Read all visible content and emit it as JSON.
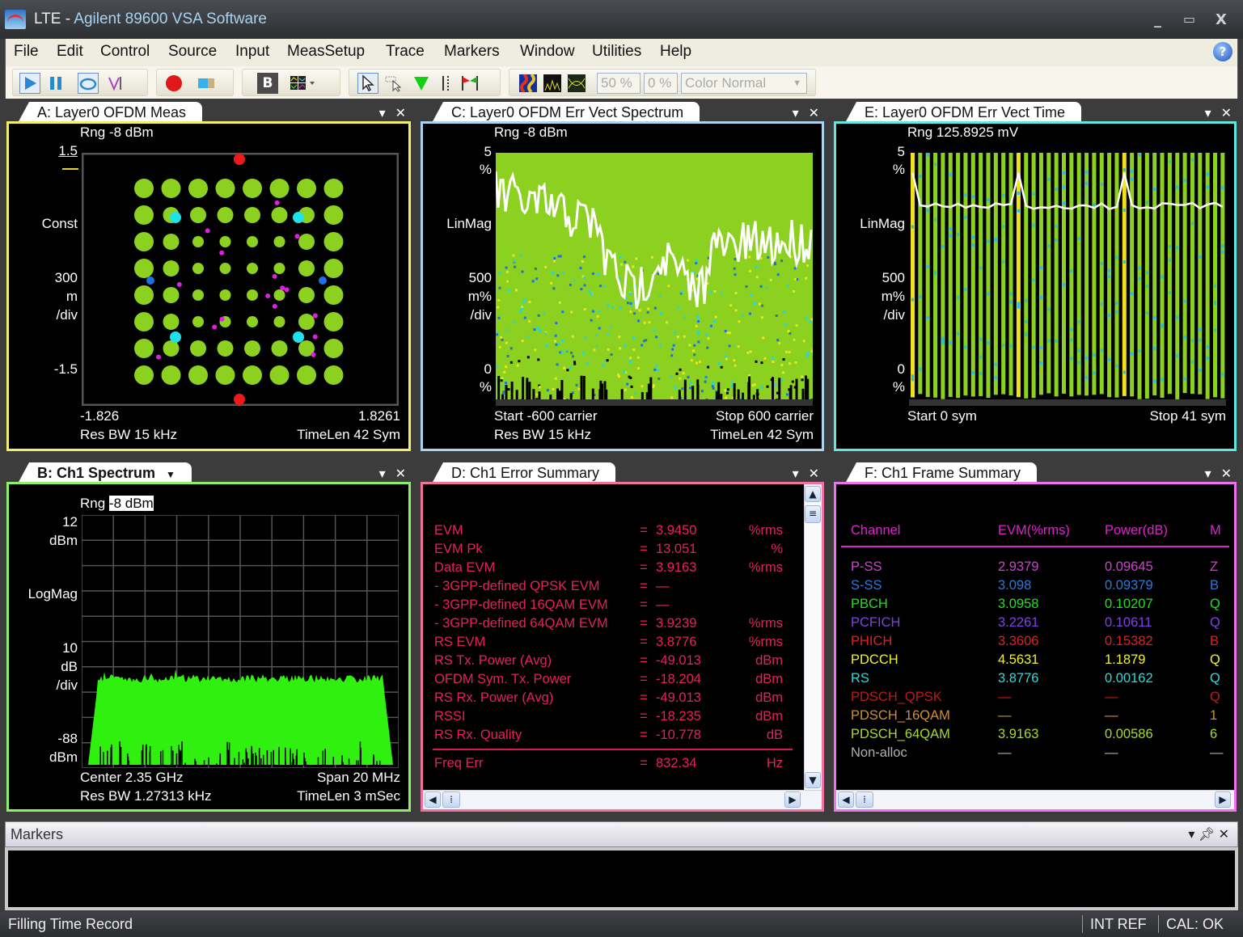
{
  "window": {
    "title_prefix": "LTE - ",
    "title_app": "Agilent 89600 VSA Software",
    "minimize_glyph": "_",
    "maximize_glyph": "▭",
    "close_glyph": "X",
    "logo_icon": "agilent-vsa-logo"
  },
  "menu": {
    "items": [
      "File",
      "Edit",
      "Control",
      "Source",
      "Input",
      "MeasSetup",
      "Trace",
      "Markers",
      "Window",
      "Utilities",
      "Help"
    ],
    "help_glyph": "?"
  },
  "toolbar": {
    "buttons": [
      "play",
      "pause",
      "continuous-loop",
      "single-trigger",
      "record",
      "playback-source",
      "bold-text",
      "layout-grid",
      "pointer",
      "zoom-pointer",
      "marker-peak",
      "marker-lines",
      "marker-flag",
      "spectrogram",
      "trace-digital-persistence",
      "trace-eye"
    ],
    "bold_label": "B",
    "percent_a": "50 %",
    "percent_b": "0 %",
    "color_select": "Color Normal"
  },
  "panels": {
    "A": {
      "title": "A: Layer0 OFDM Meas",
      "border": "#f2ef64",
      "rng": "Rng -8 dBm",
      "y_top": "1.5",
      "y_format": "Const",
      "y_scale": [
        "300",
        "m",
        "/div"
      ],
      "y_bottom": "-1.5",
      "x_left": "-1.826",
      "x_right": "1.8261",
      "bottom_left": "Res BW 15 kHz",
      "bottom_right": "TimeLen 42  Sym"
    },
    "B": {
      "title": "B: Ch1 Spectrum",
      "border": "#8cf06c",
      "rng_label": "Rng ",
      "rng_value": "-8 dBm",
      "y_top": [
        "12",
        "dBm"
      ],
      "y_format": "LogMag",
      "y_scale": [
        "10",
        "dB",
        "/div"
      ],
      "y_bottom": [
        "-88",
        "dBm"
      ],
      "bottom_left_1": "Center 2.35 GHz",
      "bottom_right_1": "Span 20 MHz",
      "bottom_left_2": "Res BW 1.27313 kHz",
      "bottom_right_2": "TimeLen 3 mSec"
    },
    "C": {
      "title": "C: Layer0 OFDM Err Vect Spectrum",
      "border": "#a8d4f0",
      "rng": "Rng -8 dBm",
      "y_top": [
        "5",
        "%"
      ],
      "y_format": "LinMag",
      "y_scale": [
        "500",
        "m%",
        "/div"
      ],
      "y_bottom": [
        "0",
        "%"
      ],
      "bottom_left_1": "Start -600  carrier",
      "bottom_right_1": "Stop 600  carrier",
      "bottom_left_2": "Res BW 15 kHz",
      "bottom_right_2": "TimeLen 42  Sym"
    },
    "D": {
      "title": "D: Ch1 Error Summary",
      "border": "#f070a0",
      "rows": [
        {
          "label": "EVM",
          "value": "3.9450",
          "unit": "%rms"
        },
        {
          "label": "EVM Pk",
          "value": "13.051",
          "unit": "%"
        },
        {
          "label": "Data EVM",
          "value": "3.9163",
          "unit": "%rms"
        },
        {
          "label": " - 3GPP-defined QPSK EVM",
          "value": "—",
          "unit": ""
        },
        {
          "label": " - 3GPP-defined 16QAM EVM",
          "value": "—",
          "unit": ""
        },
        {
          "label": " - 3GPP-defined 64QAM EVM",
          "value": "3.9239",
          "unit": "%rms"
        },
        {
          "label": "RS EVM",
          "value": "3.8776",
          "unit": "%rms"
        },
        {
          "label": "RS Tx. Power (Avg)",
          "value": "-49.013",
          "unit": "dBm"
        },
        {
          "label": "OFDM Sym. Tx. Power",
          "value": "-18.204",
          "unit": "dBm"
        },
        {
          "label": "RS Rx. Power (Avg)",
          "value": "-49.013",
          "unit": "dBm"
        },
        {
          "label": "RSSI",
          "value": "-18.235",
          "unit": "dBm"
        },
        {
          "label": "RS Rx. Quality",
          "value": "-10.778",
          "unit": "dB"
        }
      ],
      "rows2": [
        {
          "label": "Freq Err",
          "value": "832.34",
          "unit": "Hz"
        }
      ],
      "eq": "="
    },
    "E": {
      "title": "E: Layer0 OFDM Err Vect Time",
      "border": "#5ee8e0",
      "rng": "Rng 125.8925 mV",
      "y_top": [
        "5",
        "%"
      ],
      "y_format": "LinMag",
      "y_scale": [
        "500",
        "m%",
        "/div"
      ],
      "y_bottom": [
        "0",
        "%"
      ],
      "bottom_left": "Start 0  sym",
      "bottom_right": "Stop 41  sym"
    },
    "F": {
      "title": "F: Ch1 Frame Summary",
      "border": "#f070f0",
      "headers": [
        "Channel",
        "EVM(%rms)",
        "Power(dB)",
        "M"
      ],
      "header_color": "#e020d0",
      "rows": [
        {
          "channel": "P-SS",
          "evm": "2.9379",
          "power": "0.09645",
          "mod": "Z",
          "color": "#d040d0"
        },
        {
          "channel": "S-SS",
          "evm": "3.098",
          "power": "0.09379",
          "mod": "B",
          "color": "#2f78d8"
        },
        {
          "channel": "PBCH",
          "evm": "3.0958",
          "power": "0.10207",
          "mod": "Q",
          "color": "#20e020"
        },
        {
          "channel": "PCFICH",
          "evm": "3.2261",
          "power": "0.10611",
          "mod": "Q",
          "color": "#8040e8"
        },
        {
          "channel": "PHICH",
          "evm": "3.3606",
          "power": "0.15382",
          "mod": "B",
          "color": "#e02020"
        },
        {
          "channel": "PDCCH",
          "evm": "4.5631",
          "power": "1.1879",
          "mod": "Q",
          "color": "#f0f030"
        },
        {
          "channel": "RS",
          "evm": "3.8776",
          "power": "0.00162",
          "mod": "Q",
          "color": "#30d8d8"
        },
        {
          "channel": "PDSCH_QPSK",
          "evm": "—",
          "power": "—",
          "mod": "Q",
          "color": "#c01818"
        },
        {
          "channel": "PDSCH_16QAM",
          "evm": "—",
          "power": "—",
          "mod": "1",
          "color": "#d09030"
        },
        {
          "channel": "PDSCH_64QAM",
          "evm": "3.9163",
          "power": "0.00586",
          "mod": "6",
          "color": "#a8d830"
        },
        {
          "channel": "Non-alloc",
          "evm": "—",
          "power": "—",
          "mod": "—",
          "color": "#b0b0b0"
        }
      ]
    }
  },
  "markers_pane": {
    "title": "Markers"
  },
  "status": {
    "left": "Filling Time Record",
    "int_ref": "INT REF",
    "cal": "CAL: OK"
  }
}
